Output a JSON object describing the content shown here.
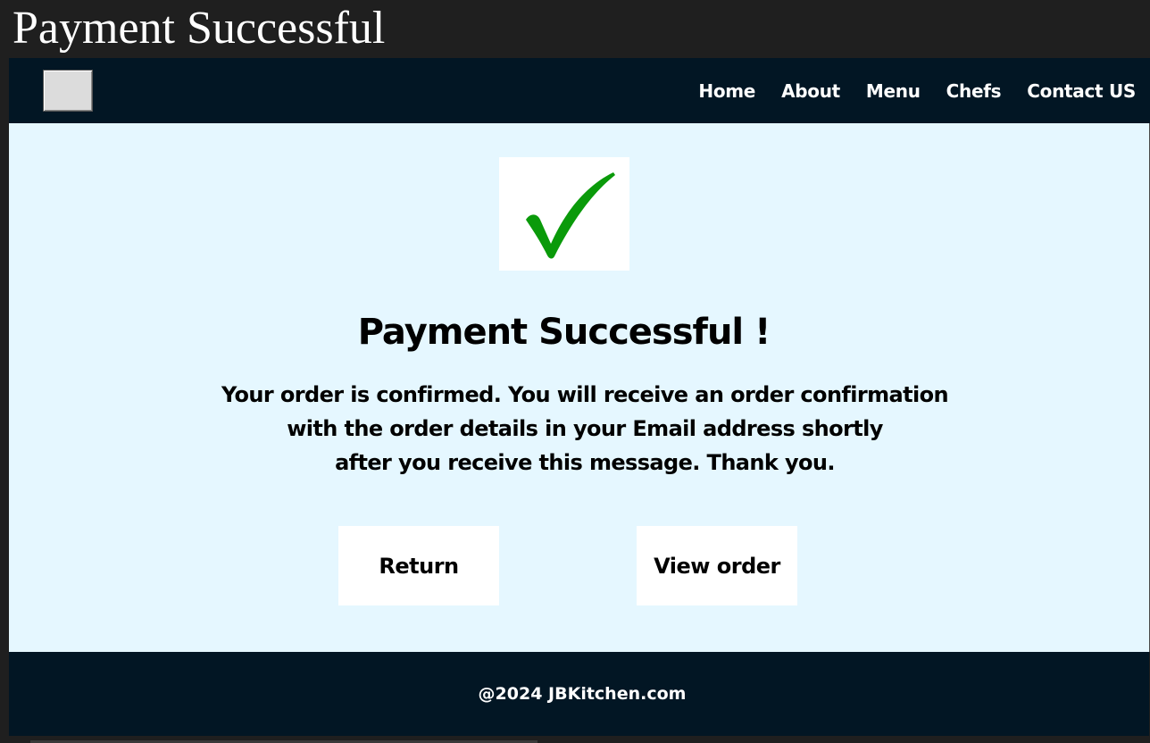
{
  "page": {
    "title": "Payment Successful"
  },
  "navbar": {
    "links": [
      {
        "label": "Home"
      },
      {
        "label": "About"
      },
      {
        "label": "Menu"
      },
      {
        "label": "Chefs"
      },
      {
        "label": "Contact US"
      }
    ]
  },
  "main": {
    "icon": "checkmark-icon",
    "heading": "Payment Successful !",
    "message_lines": [
      "Your order is confirmed. You will receive an order confirmation",
      "with the order details in your Email address shortly",
      "after you receive this message. Thank you."
    ],
    "buttons": {
      "return_label": "Return",
      "view_order_label": "View order"
    }
  },
  "footer": {
    "text": "@2024 JBKitchen.com"
  },
  "colors": {
    "nav_background": "#021624",
    "content_background": "#e5f7ff",
    "check_green": "#0a9a0a",
    "page_background": "#1f1f1f"
  }
}
